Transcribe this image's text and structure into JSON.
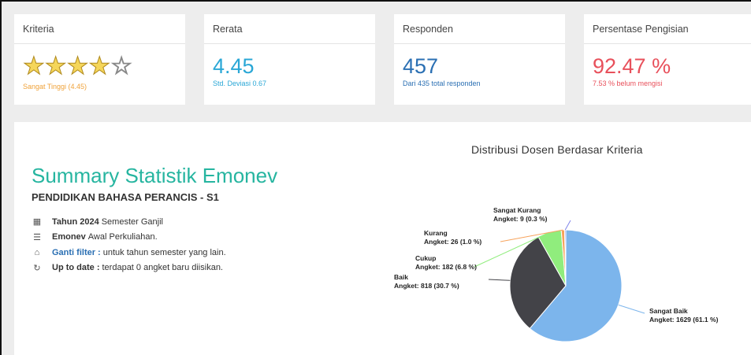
{
  "cards": {
    "kriteria": {
      "title": "Kriteria",
      "rating": 4.45,
      "max": 5,
      "label": "Sangat Tinggi (4.45)",
      "color": "#f0a33b"
    },
    "rerata": {
      "title": "Rerata",
      "value": "4.45",
      "sub": "Std. Deviasi 0.67",
      "color": "#2aa7d6"
    },
    "responden": {
      "title": "Responden",
      "value": "457",
      "sub": "Dari 435 total responden",
      "color": "#2a6fb3"
    },
    "persentase": {
      "title": "Persentase Pengisian",
      "value": "92.47 %",
      "sub": "7.53 % belum mengisi",
      "color": "#e8505b"
    }
  },
  "summary": {
    "title": "Summary Statistik Emonev",
    "program": "PENDIDIKAN BAHASA PERANCIS - S1",
    "items": [
      {
        "icon": "calendar-icon",
        "glyph": "▦",
        "bold": "Tahun 2024",
        "text": "Semester Ganjil"
      },
      {
        "icon": "list-icon",
        "glyph": "☰",
        "bold": "Emonev",
        "text": "Awal Perkuliahan."
      },
      {
        "icon": "home-icon",
        "glyph": "⌂",
        "link": "Ganti filter :",
        "text": "untuk tahun semester yang lain."
      },
      {
        "icon": "refresh-icon",
        "glyph": "↻",
        "bold": "Up to date :",
        "text": "terdapat 0 angket baru diisikan."
      }
    ]
  },
  "chart_data": {
    "type": "pie",
    "title": "Distribusi Dosen Berdasar Kriteria",
    "slices": [
      {
        "name": "Sangat Baik",
        "value": 1629,
        "pct": "61.1 %",
        "label": "Angket: 1629 (61.1 %)",
        "color": "#7cb5ec"
      },
      {
        "name": "Baik",
        "value": 818,
        "pct": "30.7 %",
        "label": "Angket: 818 (30.7 %)",
        "color": "#434348"
      },
      {
        "name": "Cukup",
        "value": 182,
        "pct": "6.8 %",
        "label": "Angket: 182 (6.8 %)",
        "color": "#90ed7d"
      },
      {
        "name": "Kurang",
        "value": 26,
        "pct": "1.0 %",
        "label": "Angket: 26 (1.0 %)",
        "color": "#f7a35c"
      },
      {
        "name": "Sangat Kurang",
        "value": 9,
        "pct": "0.3 %",
        "label": "Angket: 9 (0.3 %)",
        "color": "#8085e9"
      }
    ]
  }
}
